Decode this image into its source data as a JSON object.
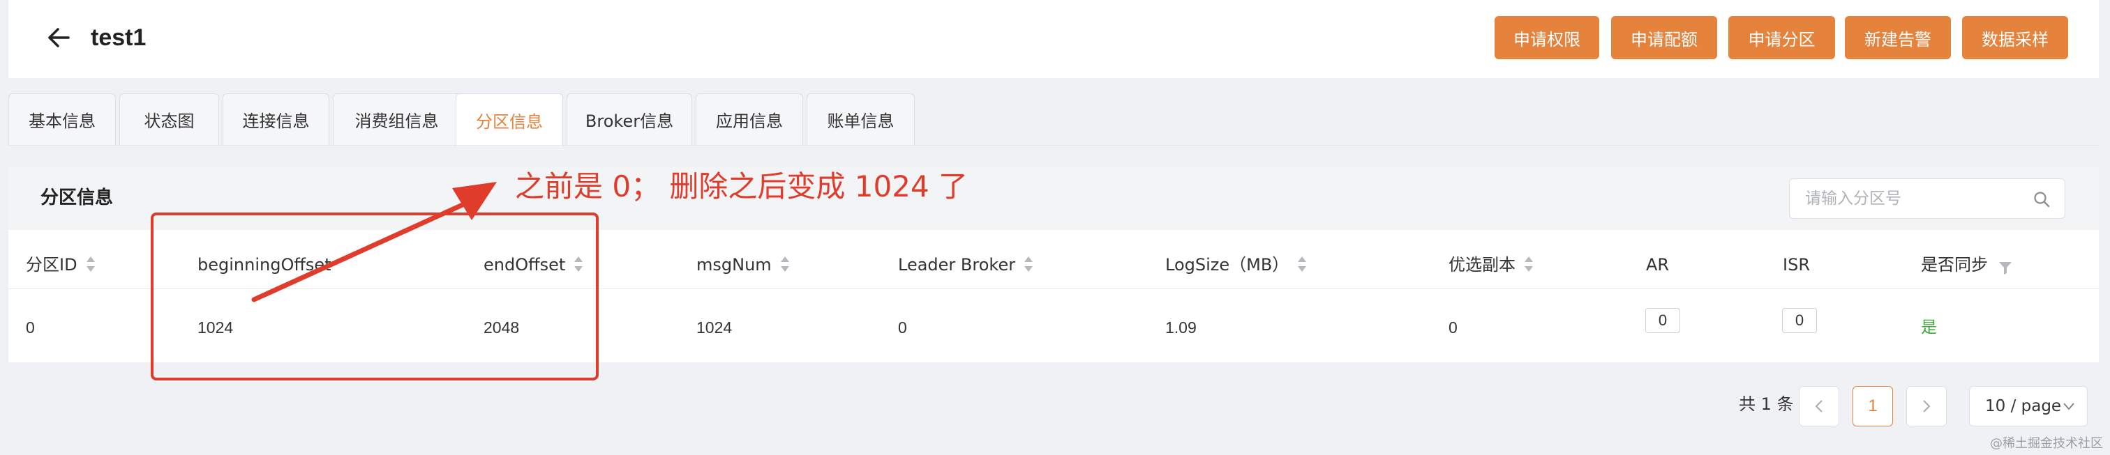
{
  "header": {
    "title": "test1",
    "actions": [
      "申请权限",
      "申请配额",
      "申请分区",
      "新建告警",
      "数据采样"
    ]
  },
  "tabs": [
    "基本信息",
    "状态图",
    "连接信息",
    "消费组信息",
    "分区信息",
    "Broker信息",
    "应用信息",
    "账单信息"
  ],
  "active_tab": "分区信息",
  "panel": {
    "title": "分区信息",
    "search_placeholder": "请输入分区号"
  },
  "table": {
    "columns": [
      "分区ID",
      "beginningOffset",
      "endOffset",
      "msgNum",
      "Leader Broker",
      "LogSize（MB）",
      "优选副本",
      "AR",
      "ISR",
      "是否同步"
    ],
    "rows": [
      {
        "partition_id": "0",
        "beginning_offset": "1024",
        "end_offset": "2048",
        "msg_num": "1024",
        "leader_broker": "0",
        "log_size": "1.09",
        "preferred_replica": "0",
        "ar": "0",
        "isr": "0",
        "in_sync": "是"
      }
    ]
  },
  "annotation": {
    "text": "之前是 0； 删除之后变成 1024 了",
    "color": "#e03c2c"
  },
  "pagination": {
    "total": "共 1 条",
    "current_page": "1",
    "page_size": "10 / page"
  },
  "watermark": "@稀土掘金技术社区",
  "colors": {
    "accent": "#e5823c",
    "success": "#3aa935",
    "annotation": "#e03c2c"
  },
  "icons": {
    "back": "arrow-left-icon",
    "search": "search-icon",
    "filter": "filter-icon",
    "prev": "chevron-left-icon",
    "next": "chevron-right-icon",
    "dropdown": "chevron-down-icon"
  }
}
